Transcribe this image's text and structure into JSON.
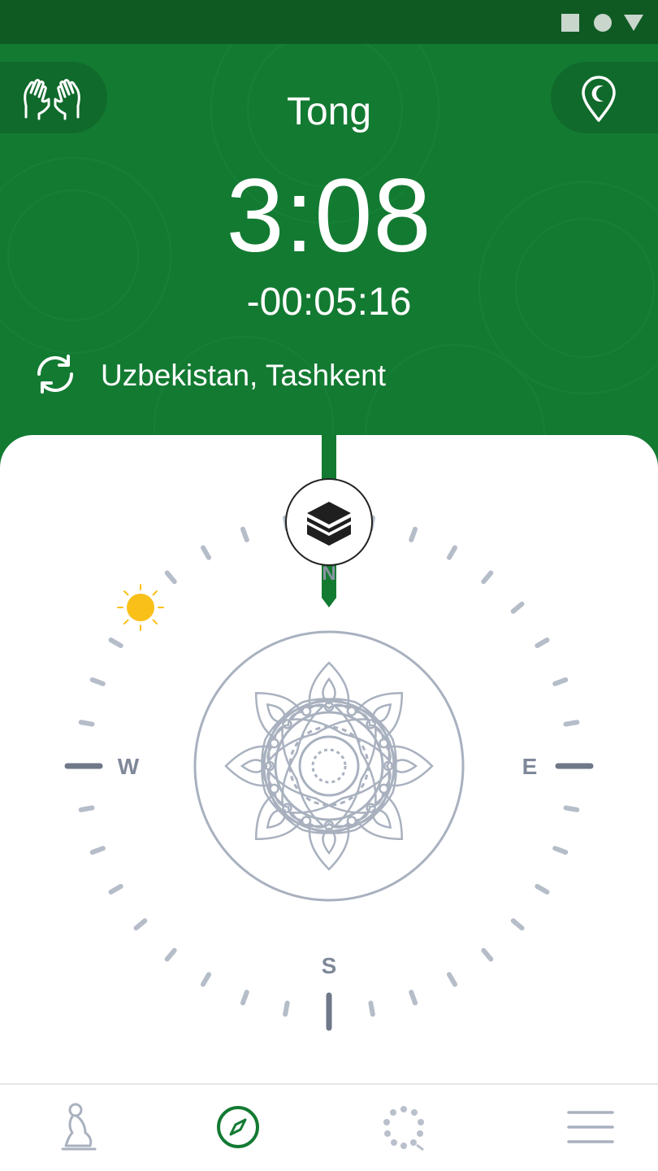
{
  "prayer": {
    "name": "Tong",
    "time": "3:08",
    "countdown": "-00:05:16"
  },
  "location": {
    "label": "Uzbekistan, Tashkent"
  },
  "compass": {
    "north": "N",
    "east": "E",
    "south": "S",
    "west": "W"
  },
  "icons": {
    "header_left": "praying-hands-icon",
    "header_right": "location-pin-icon",
    "refresh": "refresh-icon",
    "qibla": "kaaba-icon",
    "sun": "sun-icon",
    "status": [
      "square-icon",
      "circle-icon",
      "triangle-icon"
    ],
    "nav": [
      "prayer-person-icon",
      "compass-icon",
      "tasbih-icon",
      "menu-icon"
    ]
  },
  "colors": {
    "primary": "#137a32",
    "status_bar": "#0f5a23",
    "sun": "#f9c01a",
    "compass_gray": "#a9b1bf"
  },
  "nav": {
    "active_index": 1
  }
}
